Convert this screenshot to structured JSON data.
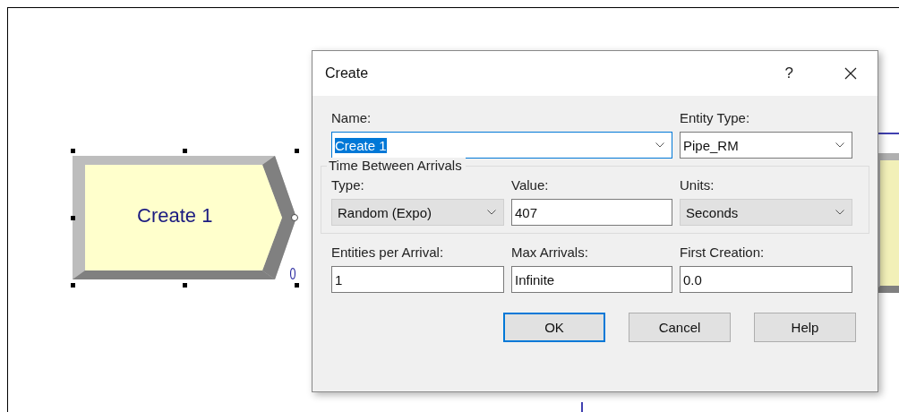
{
  "canvas": {
    "module": {
      "label": "Create 1",
      "count": "0",
      "selected": true
    }
  },
  "dialog": {
    "title": "Create",
    "help": "?",
    "rows": [
      {
        "fields": [
          {
            "label": "Name:",
            "value": "Create 1",
            "kind": "combo",
            "focused": true,
            "text_selected": true,
            "readonly": false
          },
          {
            "label": "Entity Type:",
            "value": "Pipe_RM",
            "kind": "combo",
            "focused": false,
            "text_selected": false,
            "readonly": false
          }
        ]
      },
      {
        "group": "Time Between Arrivals",
        "fields": [
          {
            "label": "Type:",
            "value": "Random (Expo)",
            "kind": "combo",
            "focused": false,
            "text_selected": false,
            "readonly": true
          },
          {
            "label": "Value:",
            "value": "407",
            "kind": "text",
            "focused": false,
            "text_selected": false,
            "readonly": false
          },
          {
            "label": "Units:",
            "value": "Seconds",
            "kind": "combo",
            "focused": false,
            "text_selected": false,
            "readonly": true
          }
        ]
      },
      {
        "fields": [
          {
            "label": "Entities per Arrival:",
            "value": "1",
            "kind": "text",
            "focused": false,
            "text_selected": false,
            "readonly": false
          },
          {
            "label": "Max Arrivals:",
            "value": "Infinite",
            "kind": "text",
            "focused": false,
            "text_selected": false,
            "readonly": false
          },
          {
            "label": "First Creation:",
            "value": "0.0",
            "kind": "text",
            "focused": false,
            "text_selected": false,
            "readonly": false
          }
        ]
      }
    ],
    "buttons": [
      {
        "label": "OK",
        "default": true
      },
      {
        "label": "Cancel",
        "default": false
      },
      {
        "label": "Help",
        "default": false
      }
    ]
  }
}
